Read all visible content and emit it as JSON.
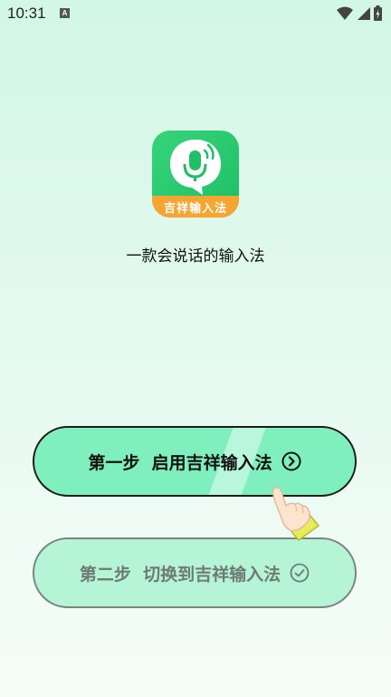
{
  "status_bar": {
    "time": "10:31",
    "notification_icon": "A"
  },
  "app": {
    "icon_name": "microphone-speech-bubble",
    "icon_label": "吉祥输入法",
    "tagline": "一款会说话的输入法"
  },
  "steps": [
    {
      "label": "第一步  启用吉祥输入法",
      "icon": "chevron-right-circle-icon"
    },
    {
      "label": "第二步  切换到吉祥输入法",
      "icon": "check-circle-icon"
    }
  ],
  "colors": {
    "bg_top": "#d2f7e6",
    "step1_fill": "#7ff0bd",
    "step2_fill": "#b5f5d6",
    "icon_green": "#1fbf66",
    "icon_orange": "#f6a531"
  }
}
